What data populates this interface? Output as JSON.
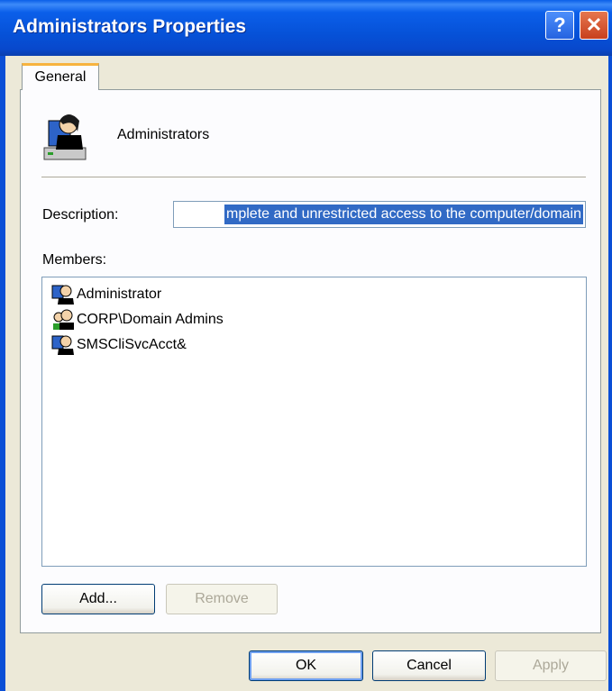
{
  "window": {
    "title": "Administrators Properties",
    "help_glyph": "?",
    "close_glyph": "✕",
    "help_icon": "help-icon",
    "close_icon": "close-icon"
  },
  "tabs": [
    {
      "label": "General",
      "selected": true
    }
  ],
  "general": {
    "group_name": "Administrators",
    "group_icon": "user-group-icon",
    "description_label": "Description:",
    "description_value": "mplete and unrestricted access to the computer/domain",
    "members_label": "Members:",
    "members": [
      {
        "name": "Administrator",
        "icon": "user-icon"
      },
      {
        "name": "CORP\\Domain Admins",
        "icon": "group-icon"
      },
      {
        "name": "SMSCliSvcAcct&",
        "icon": "user-icon"
      }
    ],
    "add_label": "Add...",
    "remove_label": "Remove",
    "remove_enabled": false
  },
  "footer": {
    "ok_label": "OK",
    "cancel_label": "Cancel",
    "apply_label": "Apply",
    "apply_enabled": false
  },
  "colors": {
    "titlebar": "#0a5ee8",
    "dialog_bg": "#ece9d8",
    "selection": "#316ac5",
    "tab_highlight": "#f7b33f"
  }
}
